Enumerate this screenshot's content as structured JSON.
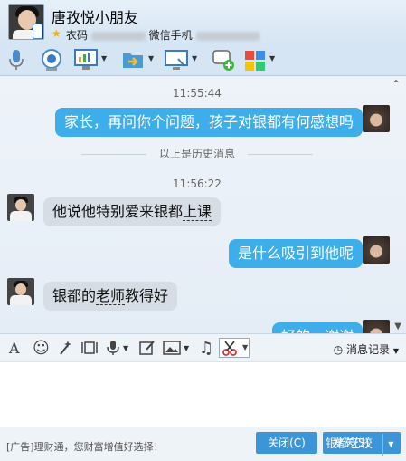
{
  "header": {
    "contact_name": "唐孜悦小朋友",
    "info_prefix": "衣码",
    "info_mid": "微信手机"
  },
  "chat": {
    "collapse_icon": "⌃",
    "messages": [
      {
        "type": "timestamp",
        "text": "11:55:44"
      },
      {
        "type": "mine",
        "text": "家长，再问你个问题，孩子对银都有何感想吗"
      },
      {
        "type": "divider",
        "text": "以上是历史消息"
      },
      {
        "type": "timestamp",
        "text": "11:56:22"
      },
      {
        "type": "theirs",
        "text_a": "他说他特别爱来银都",
        "text_b": "上课"
      },
      {
        "type": "mine",
        "text": "是什么吸引到他呢"
      },
      {
        "type": "theirs",
        "text_a": "银都的",
        "text_b": "老师",
        "text_c": "教得好"
      },
      {
        "type": "mine",
        "text": "好的，谢谢"
      }
    ]
  },
  "input_toolbar": {
    "font_icon": "A",
    "emoji_icon": "☺",
    "music_icon": "♫",
    "history_label": "消息记录"
  },
  "bottom": {
    "ad_text": "[广告]理财通，您财富增值好选择！",
    "close_label": "关闭(C)",
    "send_label": "发送(S)",
    "watermark": "银都艺校"
  },
  "colors": {
    "my_bubble": "#3daee9",
    "their_bubble": "#d6dde5",
    "button": "#3c95d6"
  }
}
